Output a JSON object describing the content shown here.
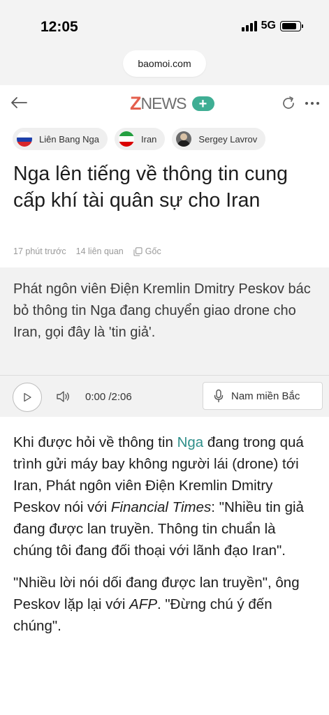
{
  "status": {
    "time": "12:05",
    "network": "5G"
  },
  "browser": {
    "url": "baomoi.com"
  },
  "header": {
    "logo_z": "Z",
    "logo_news": "NEWS",
    "plus": "+"
  },
  "tags": [
    {
      "label": "Liên Bang Nga",
      "icon": "russia-flag-icon"
    },
    {
      "label": "Iran",
      "icon": "iran-flag-icon"
    },
    {
      "label": "Sergey Lavrov",
      "icon": "person-avatar"
    }
  ],
  "article": {
    "title": "Nga lên tiếng về thông tin cung cấp khí tài quân sự cho Iran",
    "meta": {
      "time_ago": "17 phút trước",
      "related": "14 liên quan",
      "source": "Gốc"
    },
    "summary": "Phát ngôn viên Điện Kremlin Dmitry Peskov bác bỏ thông tin Nga đang chuyển giao drone cho Iran, gọi đây là 'tin giả'.",
    "audio": {
      "time": "0:00 /2:06",
      "voice": "Nam miền Bắc"
    },
    "p1": {
      "a": "Khi được hỏi về thông tin ",
      "link": "Nga",
      "b": " đang trong quá trình gửi máy bay không người lái (drone) tới Iran, Phát ngôn viên Điện Kremlin Dmitry Peskov nói với ",
      "em": "Financial Times",
      "c": ": \"Nhiều tin giả đang được lan truyền. Thông tin chuẩn là chúng tôi đang đối thoại với lãnh đạo Iran\"."
    },
    "p2": {
      "a": "\"Nhiều lời nói dối đang được lan truyền\", ông Peskov lặp lại với ",
      "em": "AFP",
      "b": ". \"Đừng chú ý đến chúng\"."
    }
  },
  "colors": {
    "accent": "#3fae94",
    "logo_red": "#e45f4d",
    "link": "#2f8f8a"
  }
}
